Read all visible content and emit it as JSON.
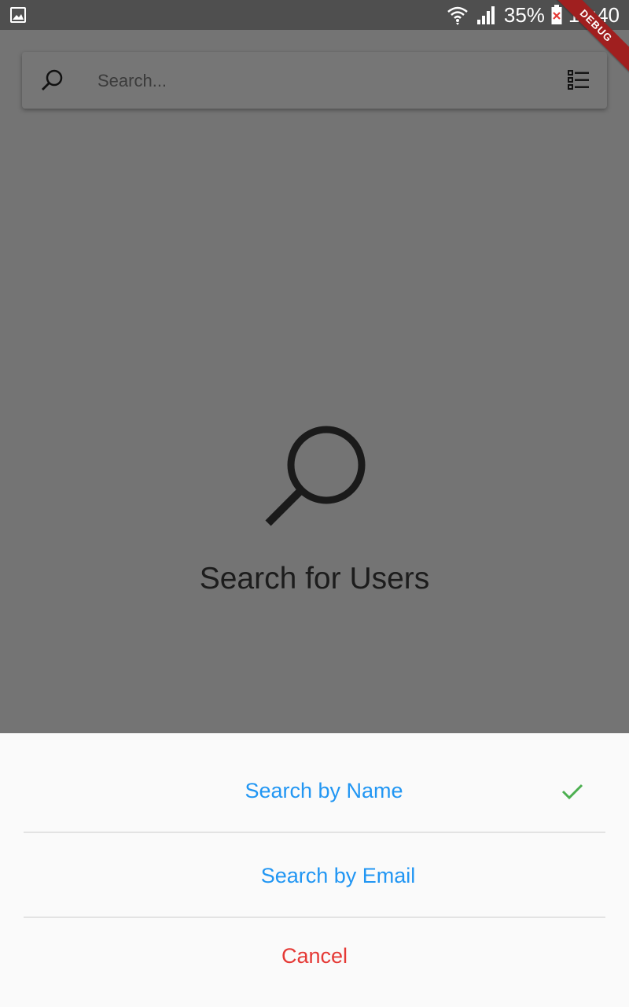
{
  "status_bar": {
    "battery": "35%",
    "time": "12:40",
    "icons": [
      "image-icon",
      "wifi-icon",
      "signal-icon",
      "battery-icon"
    ]
  },
  "debug_banner": "DEBUG",
  "search": {
    "placeholder": "Search...",
    "value": ""
  },
  "empty_state": {
    "title": "Search for Users"
  },
  "action_sheet": {
    "options": [
      {
        "label": "Search by Name",
        "selected": true
      },
      {
        "label": "Search by Email",
        "selected": false
      }
    ],
    "cancel_label": "Cancel"
  },
  "colors": {
    "accent": "#2196f3",
    "cancel": "#e53935",
    "check": "#4caf50",
    "scrim": "#747474"
  }
}
